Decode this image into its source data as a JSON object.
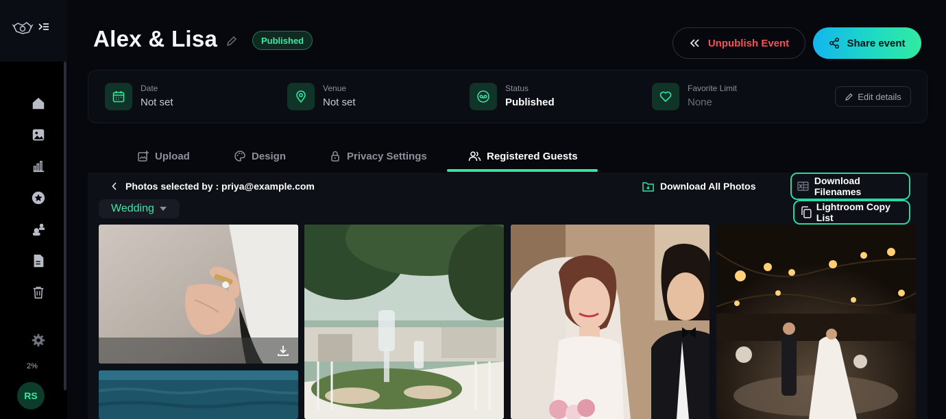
{
  "sidebar": {
    "nav": [
      {
        "name": "home-icon"
      },
      {
        "name": "gallery-icon"
      },
      {
        "name": "analytics-icon"
      },
      {
        "name": "star-icon"
      },
      {
        "name": "users-icon"
      },
      {
        "name": "document-icon"
      },
      {
        "name": "trash-icon"
      }
    ],
    "usage": "2%",
    "avatar_initials": "RS"
  },
  "header": {
    "title": "Alex & Lisa",
    "status_badge": "Published",
    "unpublish_label": "Unpublish Event",
    "share_label": "Share event"
  },
  "info": {
    "date_label": "Date",
    "date_value": "Not set",
    "venue_label": "Venue",
    "venue_value": "Not set",
    "status_label": "Status",
    "status_value": "Published",
    "favorite_label": "Favorite Limit",
    "favorite_value": "None",
    "edit_label": "Edit details"
  },
  "tabs": [
    {
      "label": "Upload",
      "active": false
    },
    {
      "label": "Design",
      "active": false
    },
    {
      "label": "Privacy Settings",
      "active": false
    },
    {
      "label": "Registered Guests",
      "active": true
    }
  ],
  "panel": {
    "back_text": "Photos selected by : priya@example.com",
    "download_all_label": "Download All Photos",
    "download_filenames_label": "Download Filenames",
    "lightroom_label": "Lightroom Copy List",
    "category": "Wedding"
  },
  "colors": {
    "accent": "#33e6a3",
    "danger": "#ff4d57",
    "background": "#07080d"
  }
}
